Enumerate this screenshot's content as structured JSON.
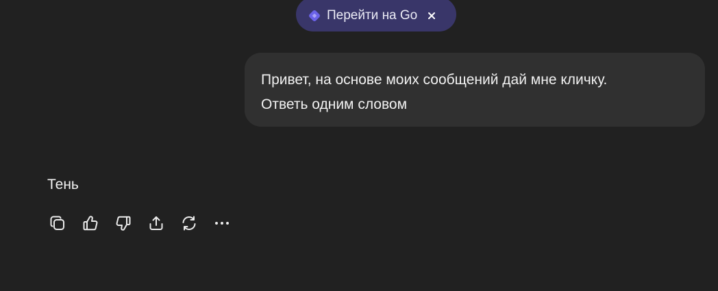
{
  "promo": {
    "label": "Перейти на Go",
    "icon": "go-diamond-icon",
    "close_icon": "close-icon",
    "accent": "#6b62e8",
    "background": "#393669"
  },
  "conversation": {
    "user_message": {
      "lines": [
        "Привет, на основе моих сообщений дай мне кличку.",
        "Ответь одним словом"
      ]
    },
    "assistant_message": {
      "text": "Тень"
    }
  },
  "message_actions": [
    {
      "name": "copy-button",
      "icon": "copy-icon"
    },
    {
      "name": "thumbs-up-button",
      "icon": "thumbs-up-icon"
    },
    {
      "name": "thumbs-down-button",
      "icon": "thumbs-down-icon"
    },
    {
      "name": "share-button",
      "icon": "share-icon"
    },
    {
      "name": "regenerate-button",
      "icon": "refresh-icon"
    },
    {
      "name": "more-actions-button",
      "icon": "more-horizontal-icon"
    }
  ],
  "colors": {
    "background": "#212121",
    "bubble": "#303030",
    "text": "#f2f2f2"
  }
}
